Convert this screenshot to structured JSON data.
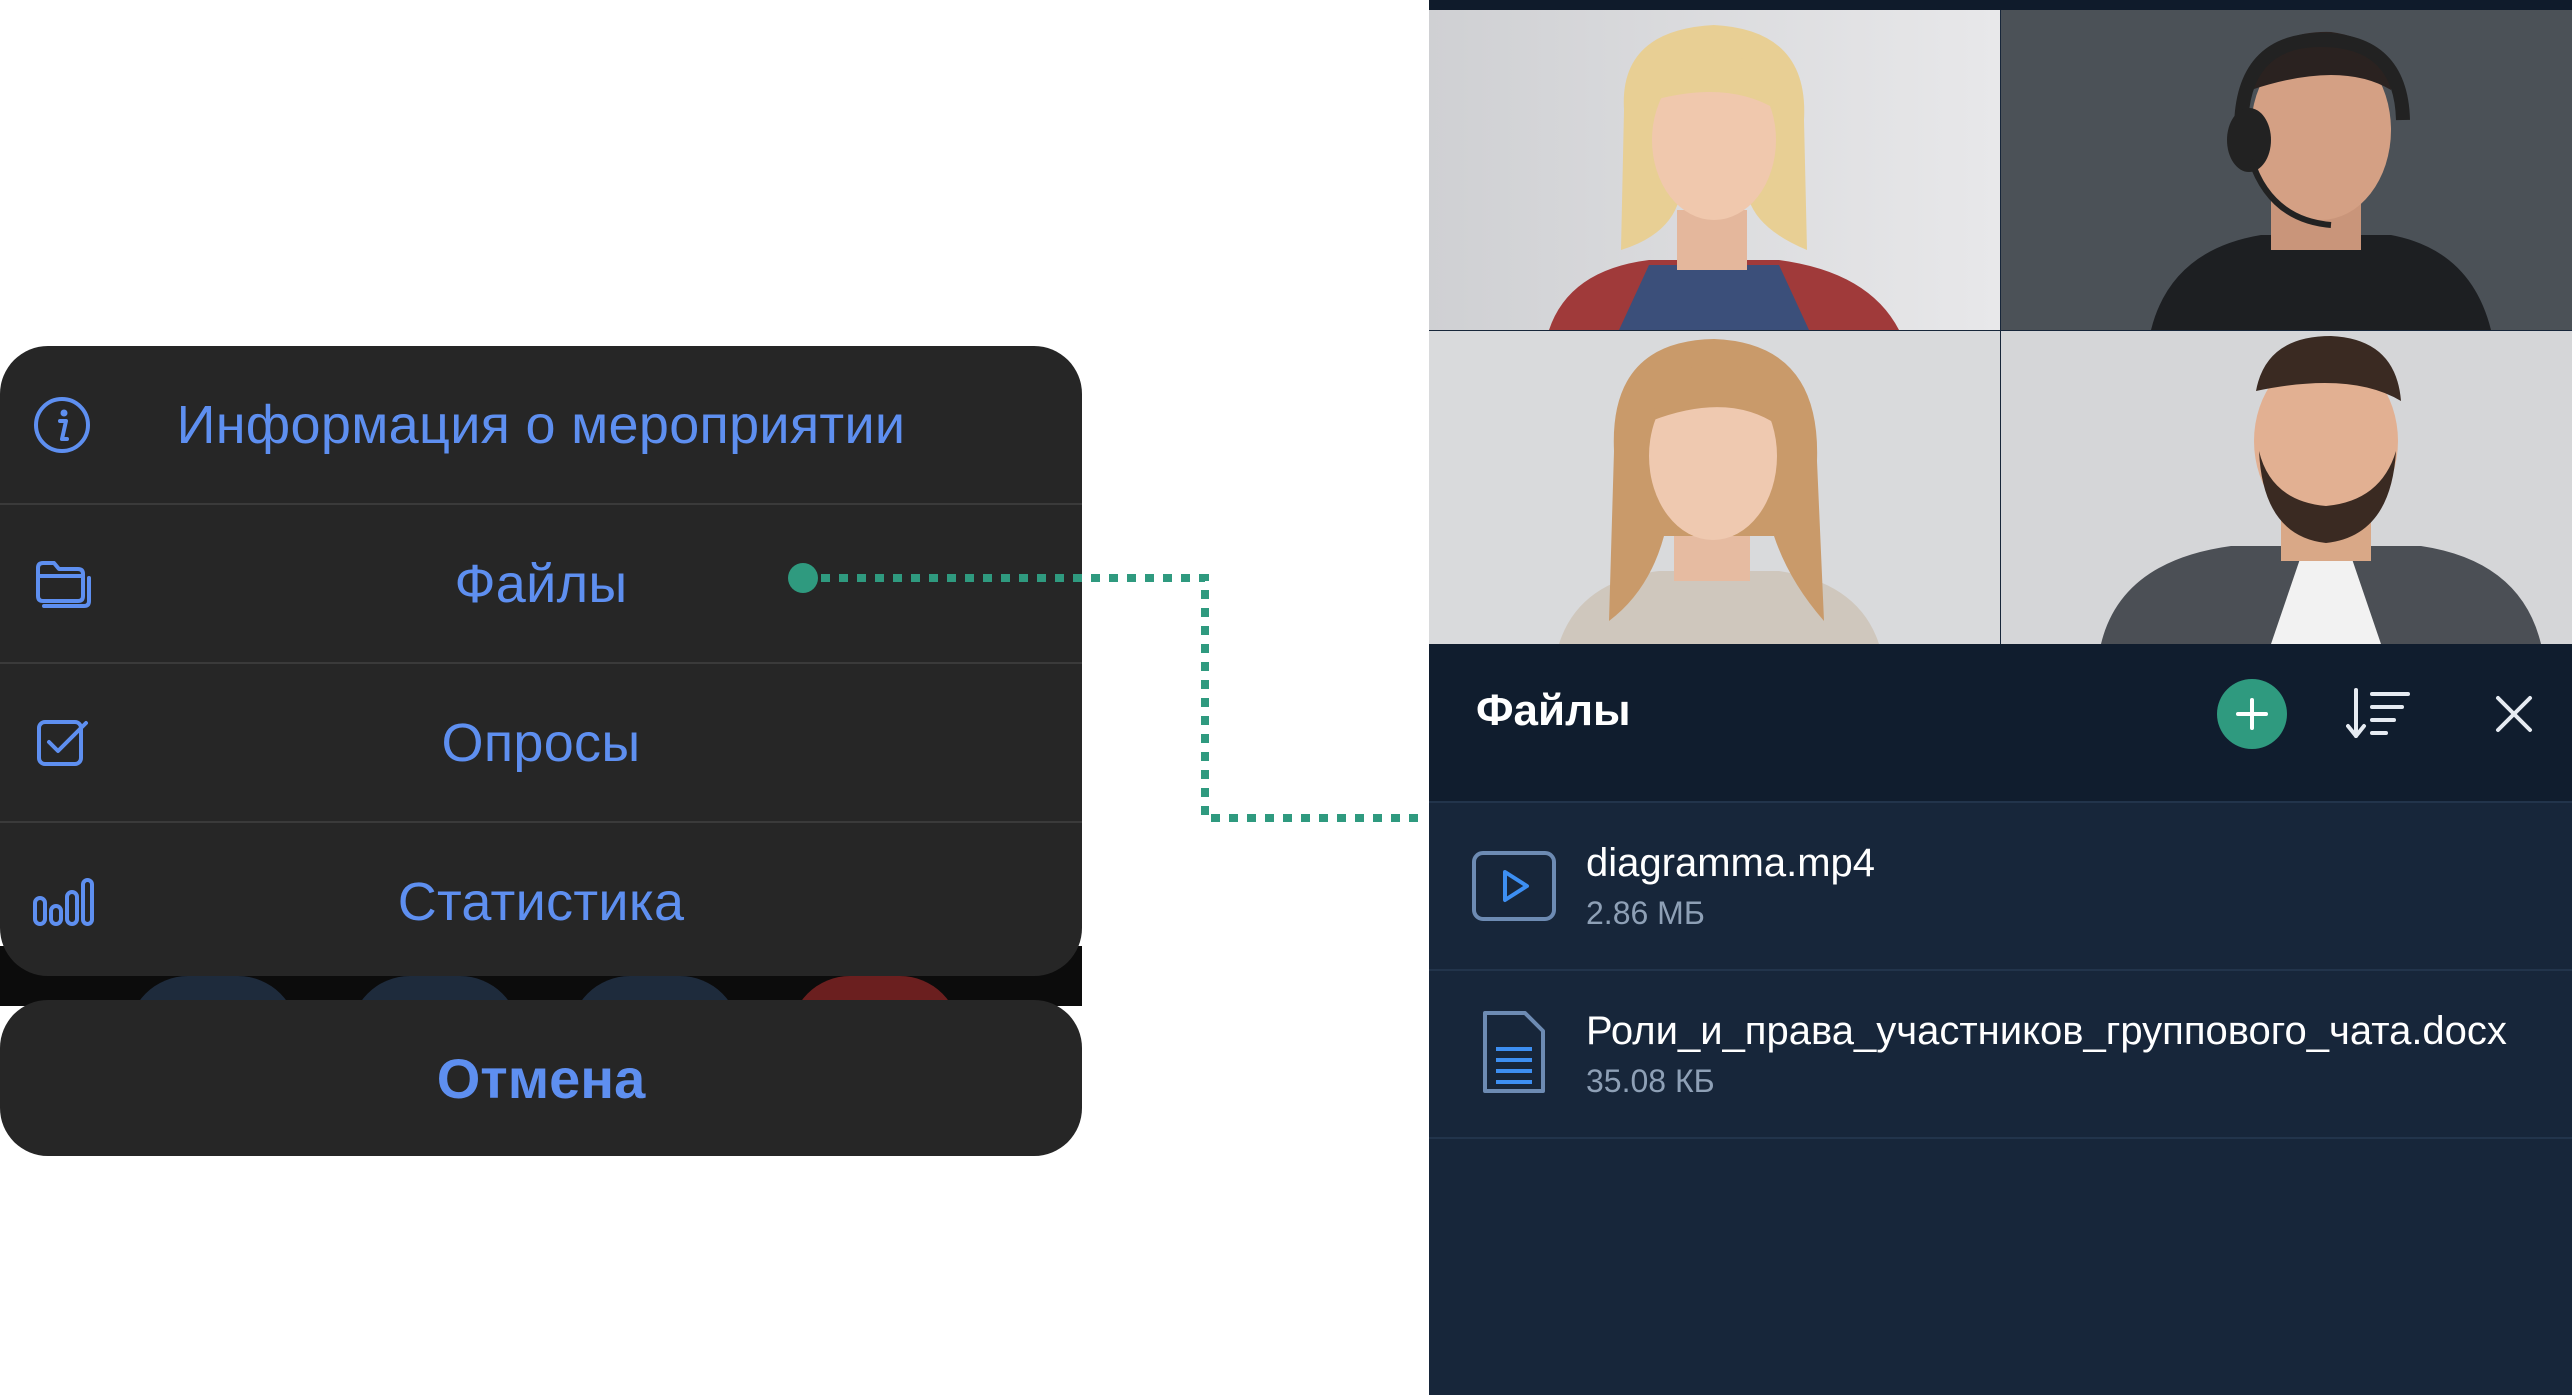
{
  "action_sheet": {
    "items": [
      {
        "label": "Информация о мероприятии",
        "icon": "info-icon"
      },
      {
        "label": "Файлы",
        "icon": "folder-icon"
      },
      {
        "label": "Опросы",
        "icon": "checkbox-icon"
      },
      {
        "label": "Статистика",
        "icon": "bar-chart-icon"
      }
    ],
    "cancel_label": "Отмена",
    "label_color": "#5e8ff0"
  },
  "connector": {
    "color": "#2f9a7f"
  },
  "files_panel": {
    "title": "Файлы",
    "add_icon": "plus-icon",
    "sort_icon": "sort-icon",
    "close_icon": "close-icon",
    "accent_color": "#2f9a7f",
    "files": [
      {
        "name": "diagramma.mp4",
        "size": "2.86 МБ",
        "icon": "video-file-icon"
      },
      {
        "name": "Роли_и_права_участников_группового_чата.docx",
        "size": "35.08 КБ",
        "icon": "document-file-icon"
      }
    ]
  },
  "video_grid": {
    "participants": [
      "participant-1",
      "participant-2",
      "participant-3",
      "participant-4"
    ]
  }
}
